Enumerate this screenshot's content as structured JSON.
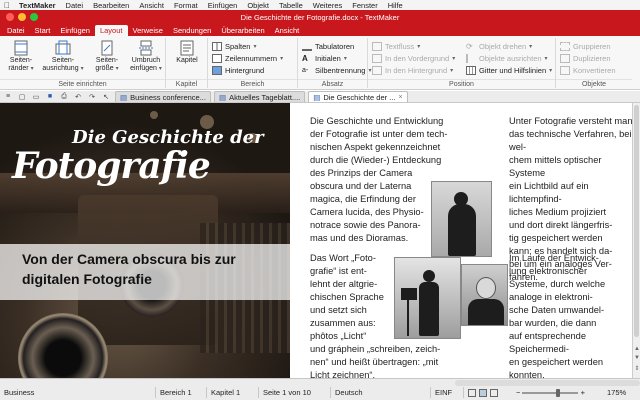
{
  "menubar": {
    "apple": "",
    "items": [
      "TextMaker",
      "Datei",
      "Bearbeiten",
      "Ansicht",
      "Format",
      "Einfügen",
      "Objekt",
      "Tabelle",
      "Weiteres",
      "Fenster",
      "Hilfe"
    ]
  },
  "window": {
    "title": "Die Geschichte der Fotografie.docx - TextMaker"
  },
  "ribbon_tabs": [
    "Datei",
    "Start",
    "Einfügen",
    "Layout",
    "Verweise",
    "Sendungen",
    "Überarbeiten",
    "Ansicht"
  ],
  "active_tab": "Layout",
  "ribbon": {
    "seite": {
      "label": "Seite einrichten",
      "b1": "Seiten-",
      "b1b": "ränder",
      "b2": "Seiten-",
      "b2b": "ausrichtung",
      "b3": "Seiten-",
      "b3b": "größe",
      "b4": "Umbruch",
      "b4b": "einfügen"
    },
    "kapitel": {
      "label": "Kapitel",
      "btn": "Kapitel"
    },
    "bereich": {
      "label": "Bereich",
      "spalten": "Spalten",
      "zeilennummern": "Zeilennummern",
      "hintergrund": "Hintergrund"
    },
    "absatz": {
      "label": "Absatz",
      "tabulatoren": "Tabulatoren",
      "initialen": "Initialen",
      "silbentrennung": "Silbentrennung"
    },
    "position": {
      "label": "Position",
      "textfluss": "Textfluss",
      "vordergrund": "In den Vordergrund",
      "hintergrund": "In den Hintergrund",
      "drehen": "Objekt drehen",
      "ausrichten": "Objekte ausrichten",
      "gitter": "Gitter und Hilfslinien"
    },
    "objekte": {
      "label": "Objekte",
      "gruppieren": "Gruppieren",
      "duplizieren": "Duplizieren",
      "konvertieren": "Konvertieren"
    }
  },
  "doc_tabs": [
    {
      "label": "Business conference..."
    },
    {
      "label": "Aktuelles Tageblatt...."
    },
    {
      "label": "Die Geschichte der ..."
    }
  ],
  "hero": {
    "title1": "Die Geschichte der",
    "title2": "Fotografie",
    "subtitle": "Von der Camera obscura bis zur digitalen Fotografie"
  },
  "body": {
    "col1a": "Die Geschichte und Entwicklung\nder Fotografie ist unter dem tech-\nnischen Aspekt gekennzeichnet\ndurch die (Wieder-) Entdeckung\ndes Prinzips der Camera\nobscura und der Laterna\nmagica, die Erfindung der\nCamera lucida, des Physio-\nnotrace sowie des Panora-\nmas und des Dioramas.",
    "col1b": "Das Wort „Foto-\ngrafie“ ist ent-\nlehnt der altgrie-\nchischen Sprache\nund setzt sich\nzusammen aus:\nphôtos „Licht“\nund gráphein „schreiben, zeich-\nnen“ und heißt übertragen: „mit\nLicht zeichnen“.",
    "col2a": "Unter Fotografie versteht man\ndas technische Verfahren, bei wel-\nchem mittels optischer Systeme\nein Lichtbild auf ein lichtempfind-\nliches Medium projiziert\nund dort direkt längerfris-\ntig gespeichert werden\nkann; es handelt sich da-\nbei um ein analoges Ver-\nfahren.",
    "col2b": "Im Laufe der Entwick-\nlung elektronischer\nSysteme, durch welche\nanaloge in elektroni-\nsche Daten umwandel-\nbar wurden, die dann\nauf entsprechende Speichermedi-\nen gespeichert werden konnten,\nkam das digitale Verfahren auf."
  },
  "statusbar": {
    "style": "Business",
    "bereich": "Bereich 1",
    "kapitel": "Kapitel 1",
    "seite": "Seite 1 von 10",
    "sprache": "Deutsch",
    "modus": "EINF",
    "zoom": "175%"
  },
  "colors": {
    "accent": "#c8181e",
    "ribbon_bg": "#f7f7f7"
  }
}
